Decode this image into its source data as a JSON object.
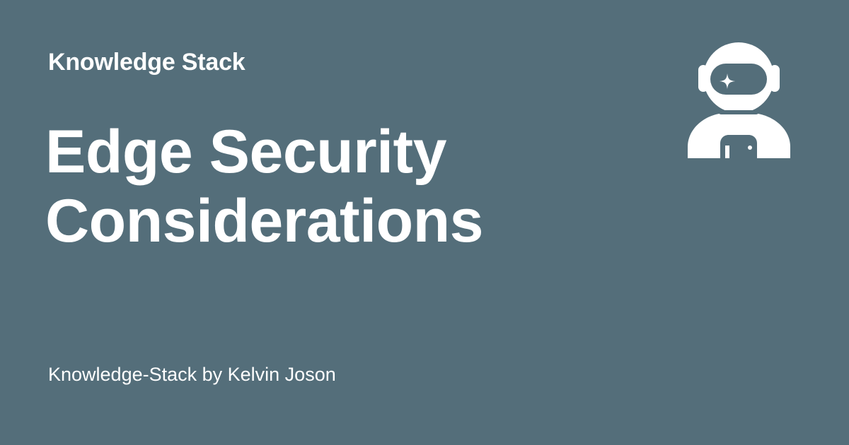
{
  "brand": {
    "site_name": "Knowledge Stack",
    "logo_icon": "astronaut-icon"
  },
  "post": {
    "title": "Edge Security Considerations",
    "byline": "Knowledge-Stack by Kelvin Joson"
  },
  "colors": {
    "background": "#546e7a",
    "foreground": "#ffffff"
  }
}
